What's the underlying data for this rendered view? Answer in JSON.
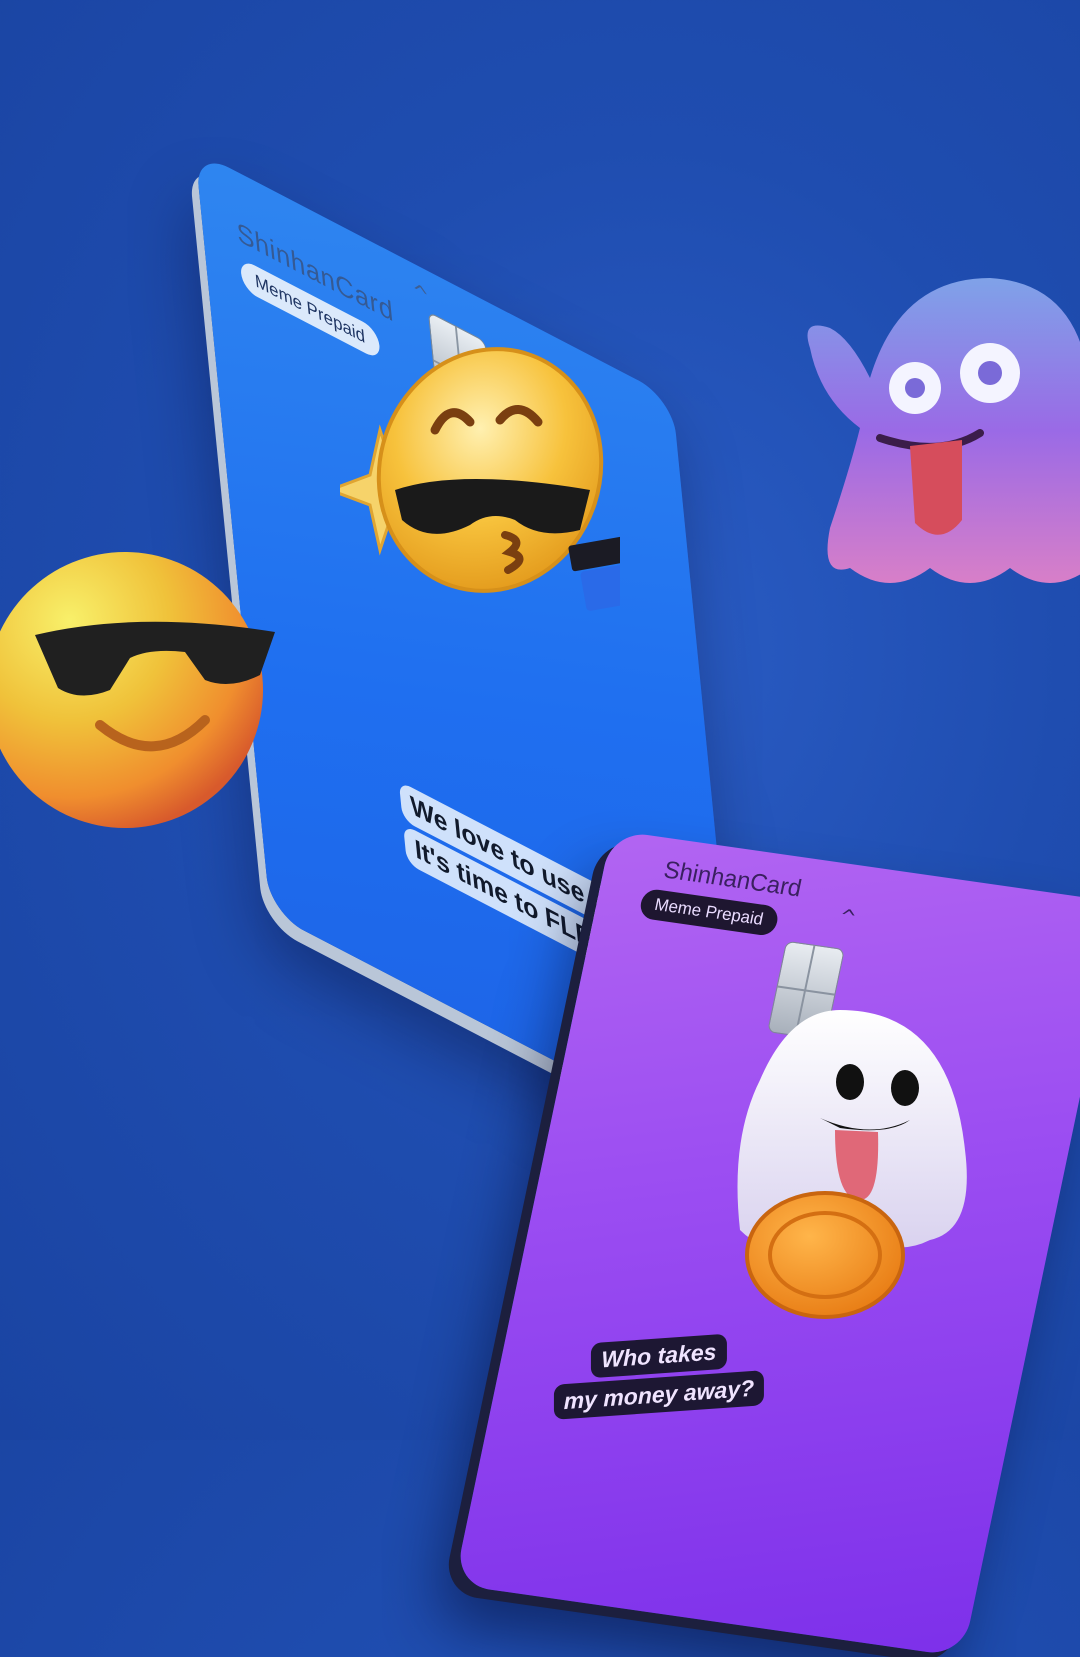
{
  "cards": {
    "blue": {
      "brand": "ShinhanCard",
      "product": "Meme Prepaid",
      "message_line1": "We love to use Card.",
      "message_line2": "It's time to FLEX!",
      "color": "#1f6ff0"
    },
    "purple": {
      "brand": "ShinhanCard",
      "product": "Meme Prepaid",
      "message_line1": "Who takes",
      "message_line2": "my money away?",
      "color": "#9c4ef2"
    }
  },
  "decorations": {
    "left_emoji": "sunglasses-smiley-icon",
    "right_emoji": "purple-ghost-icon",
    "blue_card_art": "kissing-face-with-sunglasses-icon",
    "purple_card_art": "white-ghost-with-coin-icon"
  }
}
